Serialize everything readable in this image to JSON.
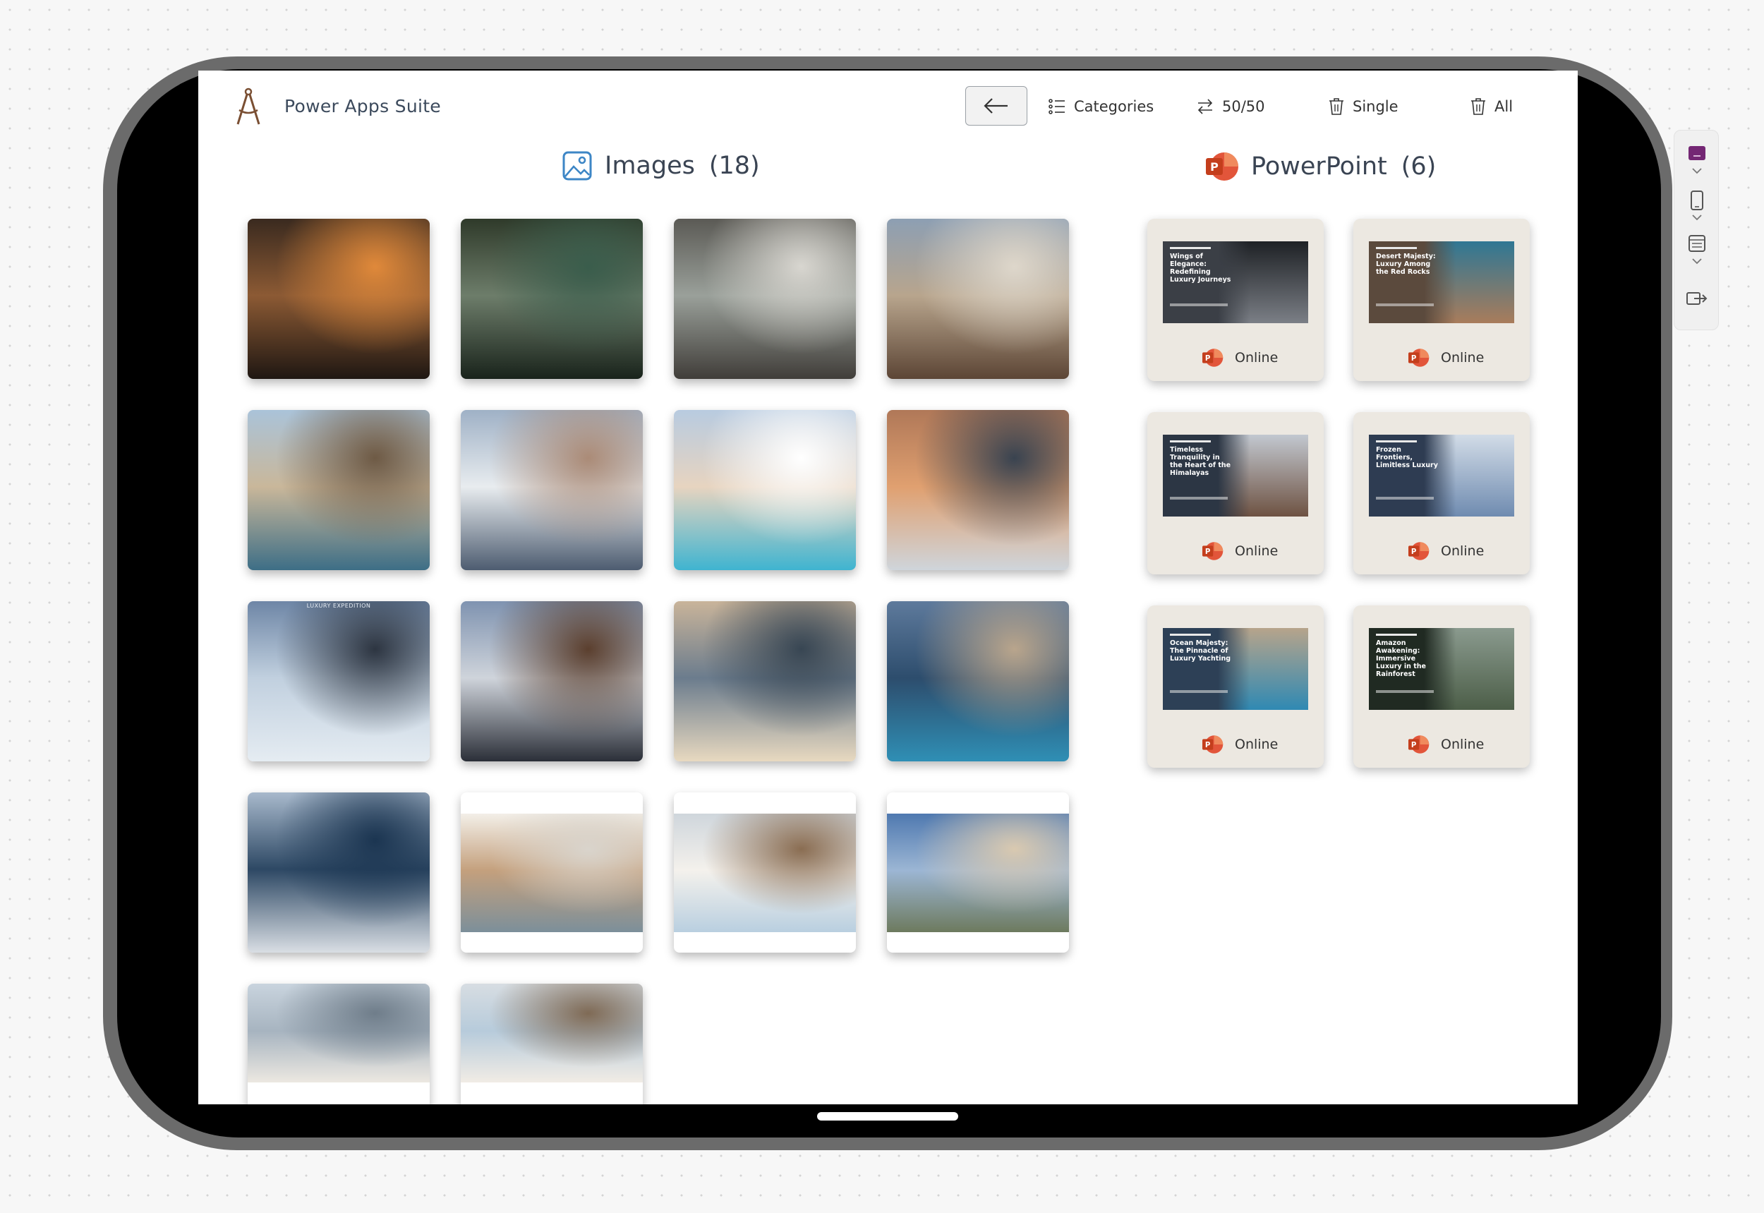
{
  "app": {
    "title": "Power Apps Suite",
    "logo_icon": "compass-icon"
  },
  "toolbar": {
    "back_icon": "arrow-left-icon",
    "categories_label": "Categories",
    "split_label": "50/50",
    "delete_single_label": "Single",
    "delete_all_label": "All"
  },
  "images_section": {
    "title": "Images",
    "count": "(18)",
    "icon": "image-icon",
    "items": [
      {
        "name": "bakery-oven",
        "colors": [
          "#3a2a1f",
          "#8c5a34",
          "#e0893a",
          "#1f1712"
        ]
      },
      {
        "name": "jungle-treehouse-pool",
        "colors": [
          "#2f3a2a",
          "#6d7d6a",
          "#3a5d4c",
          "#19231b"
        ]
      },
      {
        "name": "mountain-lounge",
        "colors": [
          "#5b5a55",
          "#9aa09a",
          "#d8d6d0",
          "#403d39"
        ]
      },
      {
        "name": "stone-fireplace-living",
        "colors": [
          "#8d9fb3",
          "#b8a58d",
          "#ded7cb",
          "#5c4535"
        ]
      },
      {
        "name": "desert-villa-pool",
        "colors": [
          "#aac3d9",
          "#c9b79a",
          "#6e5a45",
          "#3d6e86"
        ]
      },
      {
        "name": "santorini-cliffs",
        "colors": [
          "#9fb1c6",
          "#e8ecef",
          "#ab8b77",
          "#4d5c70"
        ]
      },
      {
        "name": "infinity-pool-sea",
        "colors": [
          "#b8cbe0",
          "#e7d4c0",
          "#ffffff",
          "#3fb4d0"
        ]
      },
      {
        "name": "cliff-villa-sunset",
        "colors": [
          "#b07858",
          "#e0a070",
          "#394350",
          "#cfd5db"
        ]
      },
      {
        "name": "luxury-expedition-glacier",
        "colors": [
          "#6e86a6",
          "#c1d0df",
          "#2d3541",
          "#e5ecf2"
        ],
        "label": "LUXURY EXPEDITION"
      },
      {
        "name": "himalaya-chalet",
        "colors": [
          "#7f93b0",
          "#cfd4db",
          "#5b3f2e",
          "#2b2f38"
        ]
      },
      {
        "name": "ocean-cliff-house",
        "colors": [
          "#c9b49a",
          "#6b7c8d",
          "#384653",
          "#e8d9c0"
        ]
      },
      {
        "name": "yacht-deck-pool",
        "colors": [
          "#5e7a9c",
          "#2d4d6d",
          "#b9a58c",
          "#2f8fb5"
        ]
      },
      {
        "name": "yacht-aerial",
        "colors": [
          "#a8b9cc",
          "#2d4864",
          "#1b3551",
          "#d9dee4"
        ]
      },
      {
        "name": "modern-kitchen",
        "colors": [
          "#f3efe8",
          "#c4a07d",
          "#d9d4cc",
          "#7c8f9a"
        ]
      },
      {
        "name": "ocean-bedroom",
        "colors": [
          "#cfd6dc",
          "#f4f1ec",
          "#8a6d52",
          "#b9cfe0"
        ]
      },
      {
        "name": "beach-house-dusk",
        "colors": [
          "#4f79b0",
          "#9cb6d4",
          "#d9c9b0",
          "#6d7a5e"
        ]
      },
      {
        "name": "city-view-window",
        "colors": [
          "#c9d4de",
          "#a7b4c0",
          "#6f7d8a",
          "#ece8e1"
        ]
      },
      {
        "name": "tropical-bedroom",
        "colors": [
          "#d7dde2",
          "#b7cbdb",
          "#7f6a55",
          "#f1ece5"
        ]
      }
    ]
  },
  "ppt_section": {
    "title": "PowerPoint",
    "count": "(6)",
    "icon": "powerpoint-icon",
    "items": [
      {
        "title": "Wings of Elegance: Redefining Luxury Journeys",
        "status": "Online",
        "colors": [
          "#3b3f46",
          "#7b7f86",
          "#1e2125"
        ]
      },
      {
        "title": "Desert Majesty: Luxury Among the Red Rocks",
        "status": "Online",
        "colors": [
          "#5b4a3d",
          "#a97c5b",
          "#2f7794"
        ]
      },
      {
        "title": "Timeless Tranquility in the Heart of the Himalayas",
        "status": "Online",
        "colors": [
          "#2c3644",
          "#6e5242",
          "#c2c8d0"
        ]
      },
      {
        "title": "Frozen Frontiers, Limitless Luxury",
        "status": "Online",
        "colors": [
          "#2e3c52",
          "#6f8bb0",
          "#d2dce7"
        ]
      },
      {
        "title": "Ocean Majesty: The Pinnacle of Luxury Yachting",
        "status": "Online",
        "colors": [
          "#2d4056",
          "#2f89b3",
          "#b7a48b"
        ]
      },
      {
        "title": "Amazon Awakening: Immersive Luxury in the Rainforest",
        "status": "Online",
        "colors": [
          "#202a22",
          "#4c5e48",
          "#8a9a8e"
        ]
      }
    ]
  },
  "side_toolbar": {
    "tools": [
      "app-icon",
      "phone-icon",
      "layout-icon",
      "export-icon"
    ]
  },
  "colors": {
    "accent_blue": "#3d86c6",
    "powerpoint_red": "#c8402a"
  }
}
